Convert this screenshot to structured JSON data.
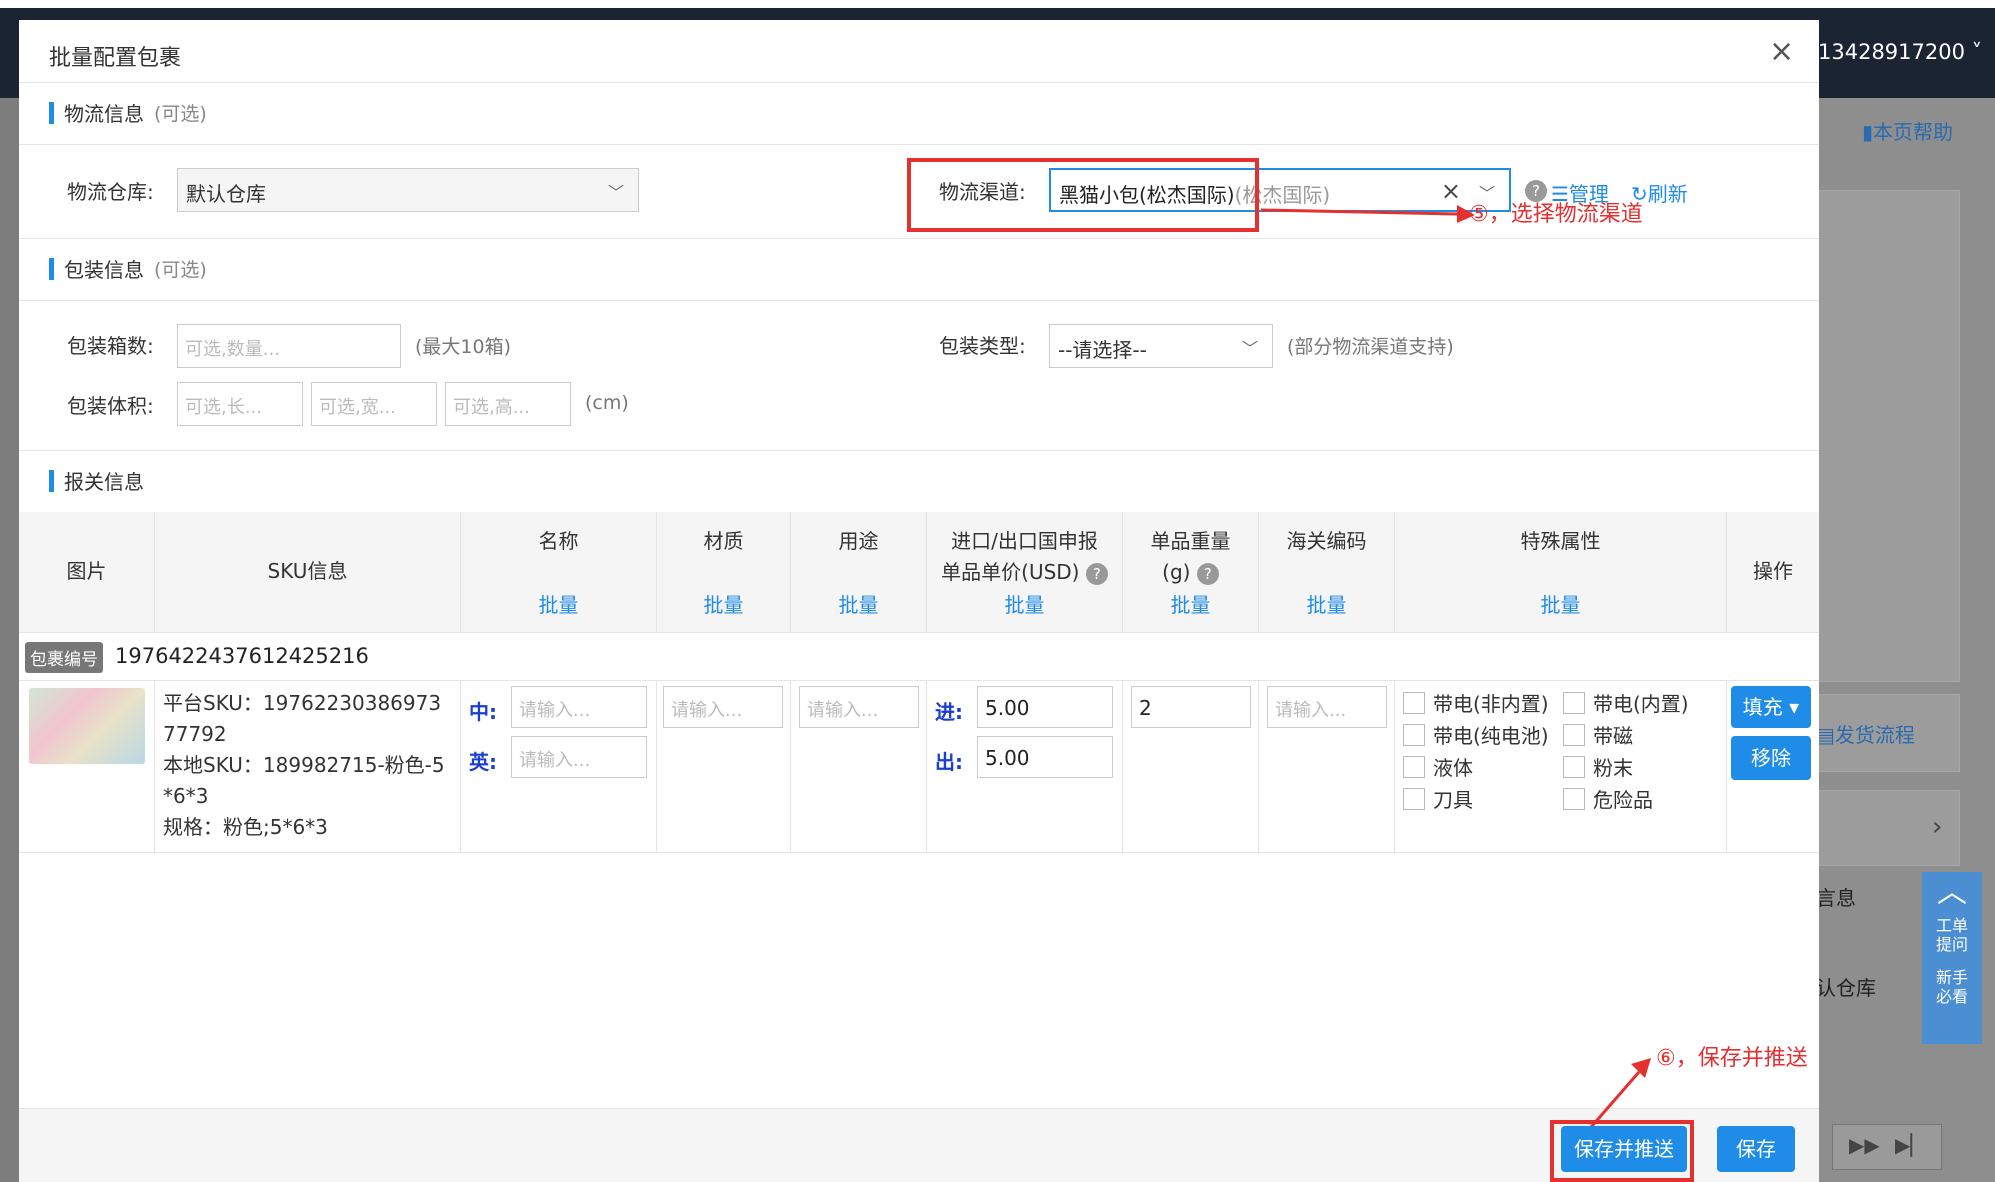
{
  "background": {
    "phone": "13428917200 ˅",
    "help": "本页帮助",
    "flow": "发货流程",
    "info_fragment": "言息",
    "warehouse_fragment": "认仓库",
    "widget_ticket": "工单提问",
    "widget_newbie": "新手必看"
  },
  "dialog": {
    "title": "批量配置包裹",
    "close_icon": "×"
  },
  "logistics": {
    "section_title": "物流信息",
    "optional": "(可选)",
    "warehouse_label": "物流仓库:",
    "warehouse_value": "默认仓库",
    "channel_label": "物流渠道:",
    "channel_value": "黑猫小包(松杰国际)",
    "channel_suffix": "(松杰国际)",
    "help_icon": "?",
    "manage": "管理",
    "refresh": "刷新",
    "annotation_step5": "⑤，选择物流渠道"
  },
  "packing": {
    "section_title": "包装信息",
    "optional": "(可选)",
    "box_count_label": "包装箱数:",
    "box_count_placeholder": "可选,数量...",
    "box_count_hint": "(最大10箱)",
    "type_label": "包装类型:",
    "type_value": "--请选择--",
    "type_hint": "(部分物流渠道支持)",
    "volume_label": "包装体积:",
    "length_placeholder": "可选,长...",
    "width_placeholder": "可选,宽...",
    "height_placeholder": "可选,高...",
    "volume_unit": "(cm)"
  },
  "customs": {
    "section_title": "报关信息",
    "headers": {
      "image": "图片",
      "sku": "SKU信息",
      "name": "名称",
      "material": "材质",
      "usage": "用途",
      "price_line1": "进口/出口国申报",
      "price_line2": "单品单价(USD)",
      "weight_line1": "单品重量",
      "weight_line2": "(g)",
      "hs_code": "海关编码",
      "special": "特殊属性",
      "action": "操作",
      "batch": "批量"
    },
    "package_badge": "包裹编号",
    "package_id": "1976422437612425216",
    "row": {
      "platform_sku_label": "平台SKU：",
      "platform_sku_value": "1976223038697377792",
      "local_sku_label": "本地SKU：",
      "local_sku_value": "189982715-粉色-5*6*3",
      "spec_label": "规格：",
      "spec_value": "粉色;5*6*3",
      "zh_label": "中:",
      "en_label": "英:",
      "input_placeholder": "请输入...",
      "import_label": "进:",
      "export_label": "出:",
      "import_price": "5.00",
      "export_price": "5.00",
      "weight": "2",
      "special_attrs": [
        "带电(非内置)",
        "带电(内置)",
        "带电(纯电池)",
        "带磁",
        "液体",
        "粉末",
        "刀具",
        "危险品"
      ],
      "fill_button": "填充 ▾",
      "remove_button": "移除"
    }
  },
  "footer": {
    "annotation_step6": "⑥，保存并推送",
    "save_push_button": "保存并推送",
    "save_button": "保存"
  },
  "colors": {
    "accent": "#1f8ce8",
    "annotation": "#e53030"
  }
}
